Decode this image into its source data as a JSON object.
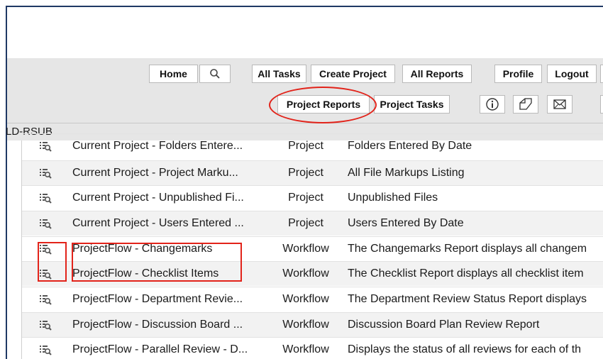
{
  "nav": {
    "home": "Home",
    "all_tasks": "All Tasks",
    "create_project": "Create Project",
    "all_reports": "All Reports",
    "profile": "Profile",
    "logout": "Logout"
  },
  "subnav": {
    "project_reports": "Project Reports",
    "project_tasks": "Project Tasks"
  },
  "icons": {
    "search": "search-icon",
    "info": "info-icon",
    "markup": "markup-icon",
    "mail": "mail-icon",
    "report": "report-search-icon"
  },
  "section": {
    "title": "LD-RSUB"
  },
  "reports": [
    {
      "name": "Current Project - Folders Entere...",
      "type": "Project",
      "description": "Folders Entered By Date"
    },
    {
      "name": "Current Project - Project Marku...",
      "type": "Project",
      "description": "All File Markups Listing"
    },
    {
      "name": "Current Project - Unpublished Fi...",
      "type": "Project",
      "description": "Unpublished Files"
    },
    {
      "name": "Current Project - Users Entered ...",
      "type": "Project",
      "description": "Users Entered By Date"
    },
    {
      "name": "ProjectFlow - Changemarks",
      "type": "Workflow",
      "description": "The Changemarks Report displays all changem"
    },
    {
      "name": "ProjectFlow - Checklist Items",
      "type": "Workflow",
      "description": "The Checklist Report displays all checklist item"
    },
    {
      "name": "ProjectFlow - Department Revie...",
      "type": "Workflow",
      "description": "The Department Review Status Report displays"
    },
    {
      "name": "ProjectFlow - Discussion Board ...",
      "type": "Workflow",
      "description": "Discussion Board Plan Review Report"
    },
    {
      "name": "ProjectFlow - Parallel Review - D...",
      "type": "Workflow",
      "description": "Displays the status of all reviews for each of th"
    }
  ],
  "colors": {
    "highlight": "#e2231a",
    "frame": "#1f3864",
    "toolbar": "#e6e6e6"
  }
}
